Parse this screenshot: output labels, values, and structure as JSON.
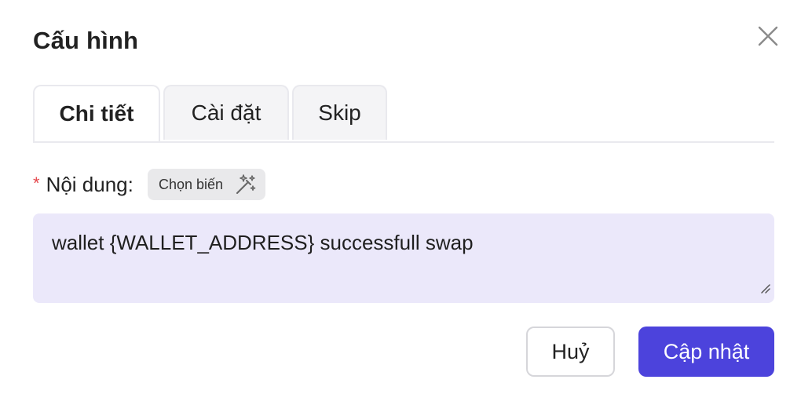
{
  "dialog": {
    "title": "Cấu hình",
    "close_icon": "close-icon"
  },
  "tabs": [
    {
      "label": "Chi tiết",
      "active": true
    },
    {
      "label": "Cài đặt",
      "active": false
    },
    {
      "label": "Skip",
      "active": false
    }
  ],
  "content_field": {
    "required_mark": "*",
    "label": "Nội dung:",
    "variable_button_label": "Chọn biến",
    "variable_button_icon": "magic-wand-icon",
    "value": "wallet {WALLET_ADDRESS} successfull swap"
  },
  "actions": {
    "cancel_label": "Huỷ",
    "update_label": "Cập nhật"
  },
  "colors": {
    "primary": "#4c43dc",
    "textarea_bg": "#ebe8fa",
    "required": "#e5484d",
    "chip_bg": "#e9e9eb"
  }
}
